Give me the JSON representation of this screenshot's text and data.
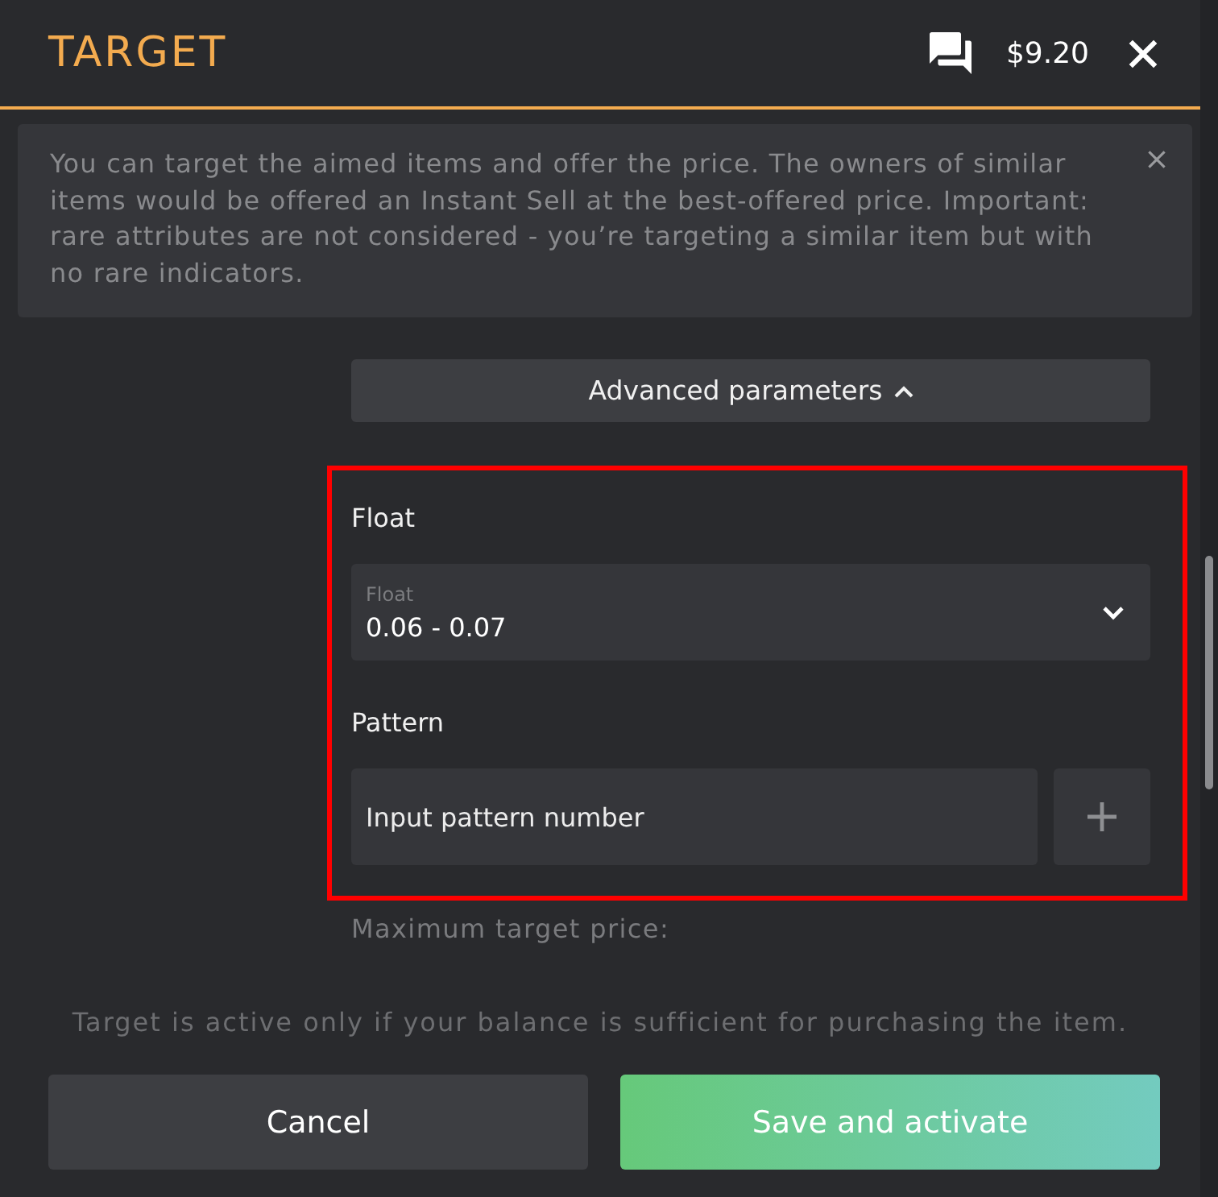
{
  "header": {
    "title": "TARGET",
    "balance": "$9.20"
  },
  "notice": {
    "text": "You can target the aimed items and offer the price. The owners of similar items would be offered an Instant Sell at the best-offered price. Important: rare attributes are not considered - you’re targeting a similar item but with no rare indicators."
  },
  "advanced_toggle": {
    "label": "Advanced parameters",
    "expanded": true
  },
  "float": {
    "label": "Float",
    "select": {
      "label": "Float",
      "value": "0.06 - 0.07"
    }
  },
  "pattern": {
    "label": "Pattern",
    "input": {
      "placeholder": "Input pattern number"
    }
  },
  "max_price": {
    "label": "Maximum target price:"
  },
  "footnote": "Target is active only if your balance is sufficient for purchasing the item.",
  "buttons": [
    {
      "label": "Cancel",
      "kind": "secondary"
    },
    {
      "label": "Save and activate",
      "kind": "primary"
    }
  ]
}
